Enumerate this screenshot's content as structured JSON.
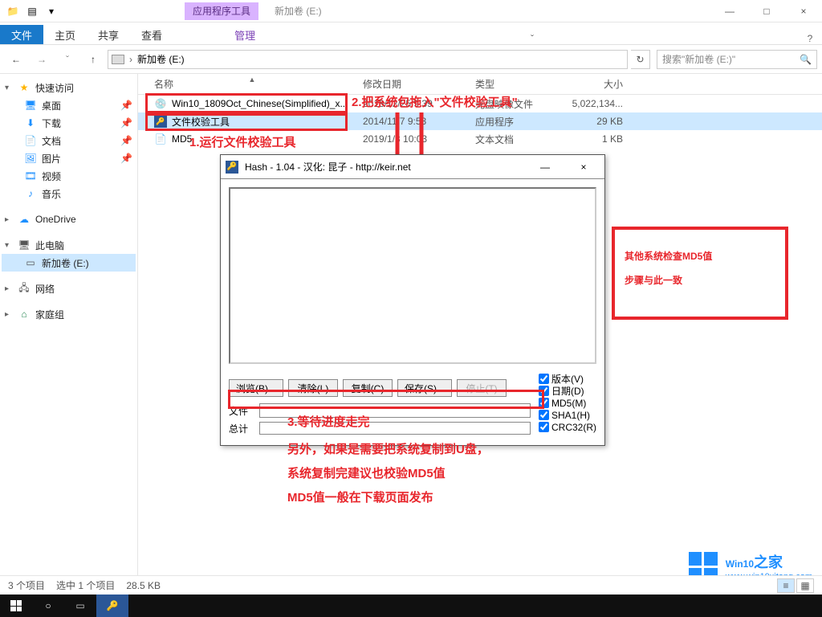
{
  "window": {
    "tool_tab": "应用程序工具",
    "title": "新加卷 (E:)",
    "min": "—",
    "max": "□",
    "close": "×"
  },
  "ribbon": {
    "file": "文件",
    "tabs": [
      "主页",
      "共享",
      "查看"
    ],
    "manage": "管理",
    "expand": "ˇ",
    "help": "?"
  },
  "nav": {
    "back": "←",
    "forward": "→",
    "recent": "ˇ",
    "up": "↑",
    "chevron": "›",
    "path": "新加卷 (E:)",
    "refresh": "↻",
    "search_placeholder": "搜索\"新加卷 (E:)\"",
    "search_icon": "🔍"
  },
  "sidebar": {
    "quick": "快速访问",
    "items": [
      {
        "label": "桌面",
        "pin": true
      },
      {
        "label": "下载",
        "pin": true
      },
      {
        "label": "文档",
        "pin": true
      },
      {
        "label": "图片",
        "pin": true
      },
      {
        "label": "视频",
        "pin": false
      },
      {
        "label": "音乐",
        "pin": false
      }
    ],
    "onedrive": "OneDrive",
    "thispc": "此电脑",
    "drive": "新加卷 (E:)",
    "network": "网络",
    "homegroup": "家庭组"
  },
  "columns": {
    "name": "名称",
    "date": "修改日期",
    "type": "类型",
    "size": "大小"
  },
  "files": [
    {
      "name": "Win10_1809Oct_Chinese(Simplified)_x...",
      "date": "2018/12/25 9:39",
      "type": "光盘映像文件",
      "size": "5,022,134..."
    },
    {
      "name": "文件校验工具",
      "date": "2014/11/7 9:53",
      "type": "应用程序",
      "size": "29 KB"
    },
    {
      "name": "MD5",
      "date": "2019/1/3 10:03",
      "type": "文本文档",
      "size": "1 KB"
    }
  ],
  "hash": {
    "title": "Hash - 1.04 - 汉化: 昆子 - http://keir.net",
    "buttons": {
      "browse": "浏览(B)...",
      "clear": "清除(L)",
      "copy": "复制(C)",
      "save": "保存(S)...",
      "stop": "停止(T)"
    },
    "checks": {
      "ver": "版本(V)",
      "date": "日期(D)",
      "md5": "MD5(M)",
      "sha1": "SHA1(H)",
      "crc32": "CRC32(R)"
    },
    "labels": {
      "file": "文件",
      "total": "总计"
    },
    "min": "—",
    "close": "×"
  },
  "annotations": {
    "step1": "1.运行文件校验工具",
    "step2": "2.把系统包拖入\"文件校验工具\"",
    "step3": "3.等待进度走完",
    "note1": "另外，如果是需要把系统复制到U盘，",
    "note2": "系统复制完建议也校验MD5值",
    "note3": "MD5值一般在下载页面发布",
    "sidebox_l1": "其他系统检查MD5值",
    "sidebox_l2": "步骤与此一致"
  },
  "watermark": {
    "brand": "Win10",
    "suffix": "之家",
    "url": "www.win10xitong.com"
  },
  "status": {
    "items": "3 个项目",
    "sel": "选中 1 个项目",
    "size": "28.5 KB"
  }
}
